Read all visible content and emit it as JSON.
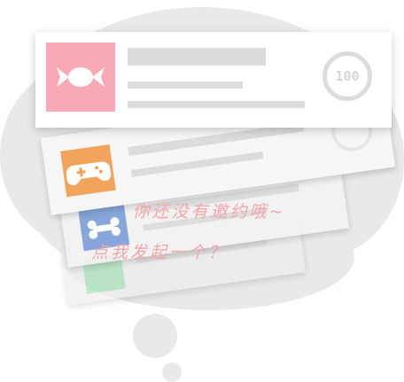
{
  "prompt": {
    "line1": "你还没有邀约哦~",
    "line2": "点我发起一个？"
  },
  "card": {
    "score": "100",
    "thumbnail_icon": "candy-icon"
  },
  "decor": {
    "icons": [
      "candy-icon",
      "gamepad-icon",
      "bone-icon"
    ],
    "colors": {
      "bubble": "#e9e9e9",
      "pink": "#f7aab6",
      "orange": "#f2a35c",
      "blue": "#7d9fd8",
      "green": "#a6e0ba",
      "message": "#f2a5ad"
    }
  }
}
